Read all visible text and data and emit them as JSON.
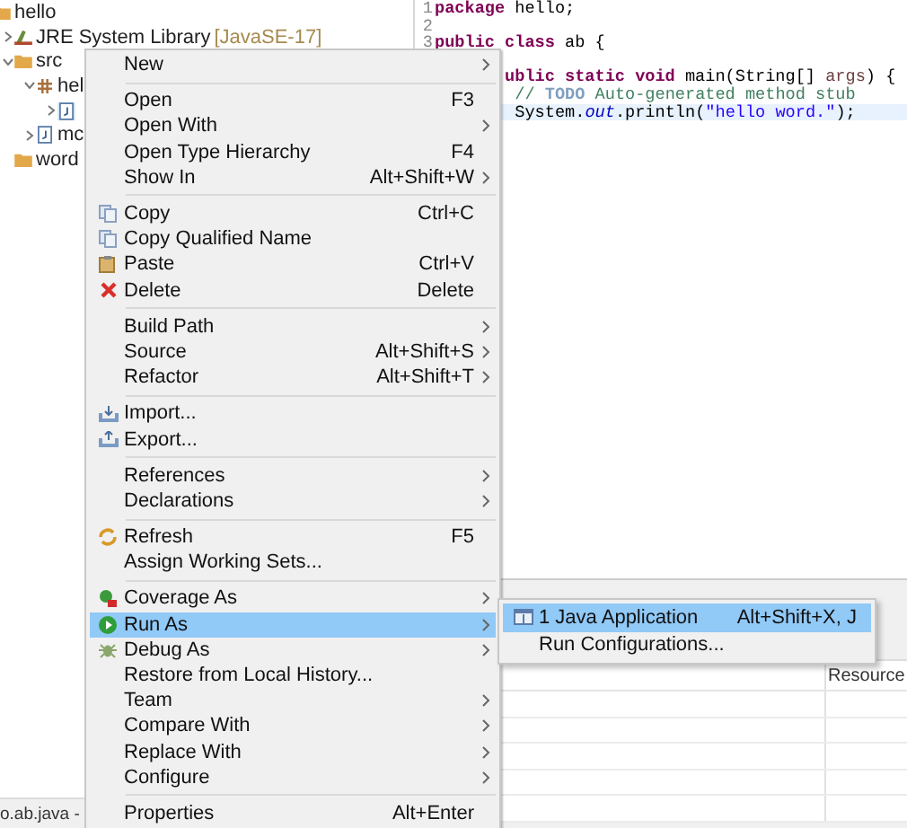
{
  "explorer": {
    "tree": [
      {
        "label": "hello",
        "kind": "project",
        "children": [
          {
            "label": "JRE System Library",
            "decoration": "[JavaSE-17]",
            "kind": "library",
            "expanded": false
          },
          {
            "label": "src",
            "kind": "source",
            "expanded": true,
            "children": [
              {
                "label": "hel",
                "kind": "package",
                "expanded": true,
                "children": [
                  {
                    "kind": "file",
                    "expanded": false,
                    "selected": true
                  }
                ]
              },
              {
                "label": "mc",
                "kind": "file",
                "expanded": false
              }
            ]
          },
          {
            "label": "word",
            "kind": "project"
          }
        ]
      }
    ],
    "status": "o.ab.java -"
  },
  "editor": {
    "lines": [
      {
        "number": "1",
        "tokens": [
          {
            "kind": "keyword",
            "text": "package"
          },
          {
            "kind": "plain",
            "text": " hello;"
          }
        ]
      },
      {
        "number": "2"
      },
      {
        "number": "3",
        "tokens": [
          {
            "kind": "keyword",
            "text": "public class"
          },
          {
            "kind": "plain",
            "text": " ab {"
          }
        ]
      },
      {
        "tokens": [
          {
            "kind": "keyword",
            "text": "ublic static void"
          },
          {
            "kind": "plain",
            "text": " main(String[] "
          },
          {
            "kind": "param",
            "text": "args"
          },
          {
            "kind": "plain",
            "text": ") {"
          }
        ]
      },
      {
        "tokens": [
          {
            "kind": "comment",
            "text": "// "
          },
          {
            "kind": "task",
            "text": "TODO"
          },
          {
            "kind": "comment",
            "text": " Auto-generated method stub"
          }
        ]
      },
      {
        "current": true,
        "tokens": [
          {
            "kind": "plain",
            "text": "System."
          },
          {
            "kind": "field",
            "text": "out"
          },
          {
            "kind": "plain",
            "text": ".println("
          },
          {
            "kind": "string",
            "text": "\"hello word.\""
          },
          {
            "kind": "plain",
            "text": ");"
          }
        ]
      }
    ]
  },
  "problems": {
    "columns": [
      "Resource"
    ]
  },
  "context_menu": {
    "groups": [
      [
        {
          "label": "New",
          "submenu": true,
          "selected": false
        }
      ],
      [
        {
          "label": "Open",
          "shortcut": "F3",
          "selected": false
        },
        {
          "label": "Open With",
          "submenu": true,
          "selected": false
        },
        {
          "label": "Open Type Hierarchy",
          "shortcut": "F4",
          "selected": false
        },
        {
          "label": "Show In",
          "shortcut": "Alt+Shift+W",
          "submenu": true,
          "selected": false
        }
      ],
      [
        {
          "label": "Copy",
          "shortcut": "Ctrl+C",
          "kind": "copy",
          "selected": false
        },
        {
          "label": "Copy Qualified Name",
          "kind": "copy",
          "selected": false
        },
        {
          "label": "Paste",
          "shortcut": "Ctrl+V",
          "kind": "paste",
          "selected": false
        },
        {
          "label": "Delete",
          "shortcut": "Delete",
          "kind": "delete",
          "selected": false
        }
      ],
      [
        {
          "label": "Build Path",
          "submenu": true,
          "selected": false
        },
        {
          "label": "Source",
          "shortcut": "Alt+Shift+S",
          "submenu": true,
          "selected": false
        },
        {
          "label": "Refactor",
          "shortcut": "Alt+Shift+T",
          "submenu": true,
          "selected": false
        }
      ],
      [
        {
          "label": "Import...",
          "kind": "import",
          "selected": false
        },
        {
          "label": "Export...",
          "kind": "export",
          "selected": false
        }
      ],
      [
        {
          "label": "References",
          "submenu": true,
          "selected": false
        },
        {
          "label": "Declarations",
          "submenu": true,
          "selected": false
        }
      ],
      [
        {
          "label": "Refresh",
          "shortcut": "F5",
          "kind": "refresh",
          "selected": false
        },
        {
          "label": "Assign Working Sets...",
          "selected": false
        }
      ],
      [
        {
          "label": "Coverage As",
          "submenu": true,
          "kind": "coverage",
          "selected": false
        },
        {
          "label": "Run As",
          "submenu": true,
          "kind": "run",
          "selected": true
        },
        {
          "label": "Debug As",
          "submenu": true,
          "kind": "debug",
          "selected": false
        },
        {
          "label": "Restore from Local History...",
          "selected": false
        },
        {
          "label": "Team",
          "submenu": true,
          "selected": false
        },
        {
          "label": "Compare With",
          "submenu": true,
          "selected": false
        },
        {
          "label": "Replace With",
          "submenu": true,
          "selected": false
        },
        {
          "label": "Configure",
          "submenu": true,
          "selected": false
        }
      ],
      [
        {
          "label": "Properties",
          "shortcut": "Alt+Enter",
          "selected": false
        }
      ]
    ]
  },
  "submenu": {
    "items": [
      {
        "label": "1 Java Application",
        "shortcut": "Alt+Shift+X, J",
        "kind": "application",
        "selected": true
      },
      {
        "label": "Run Configurations...",
        "selected": false
      }
    ]
  }
}
